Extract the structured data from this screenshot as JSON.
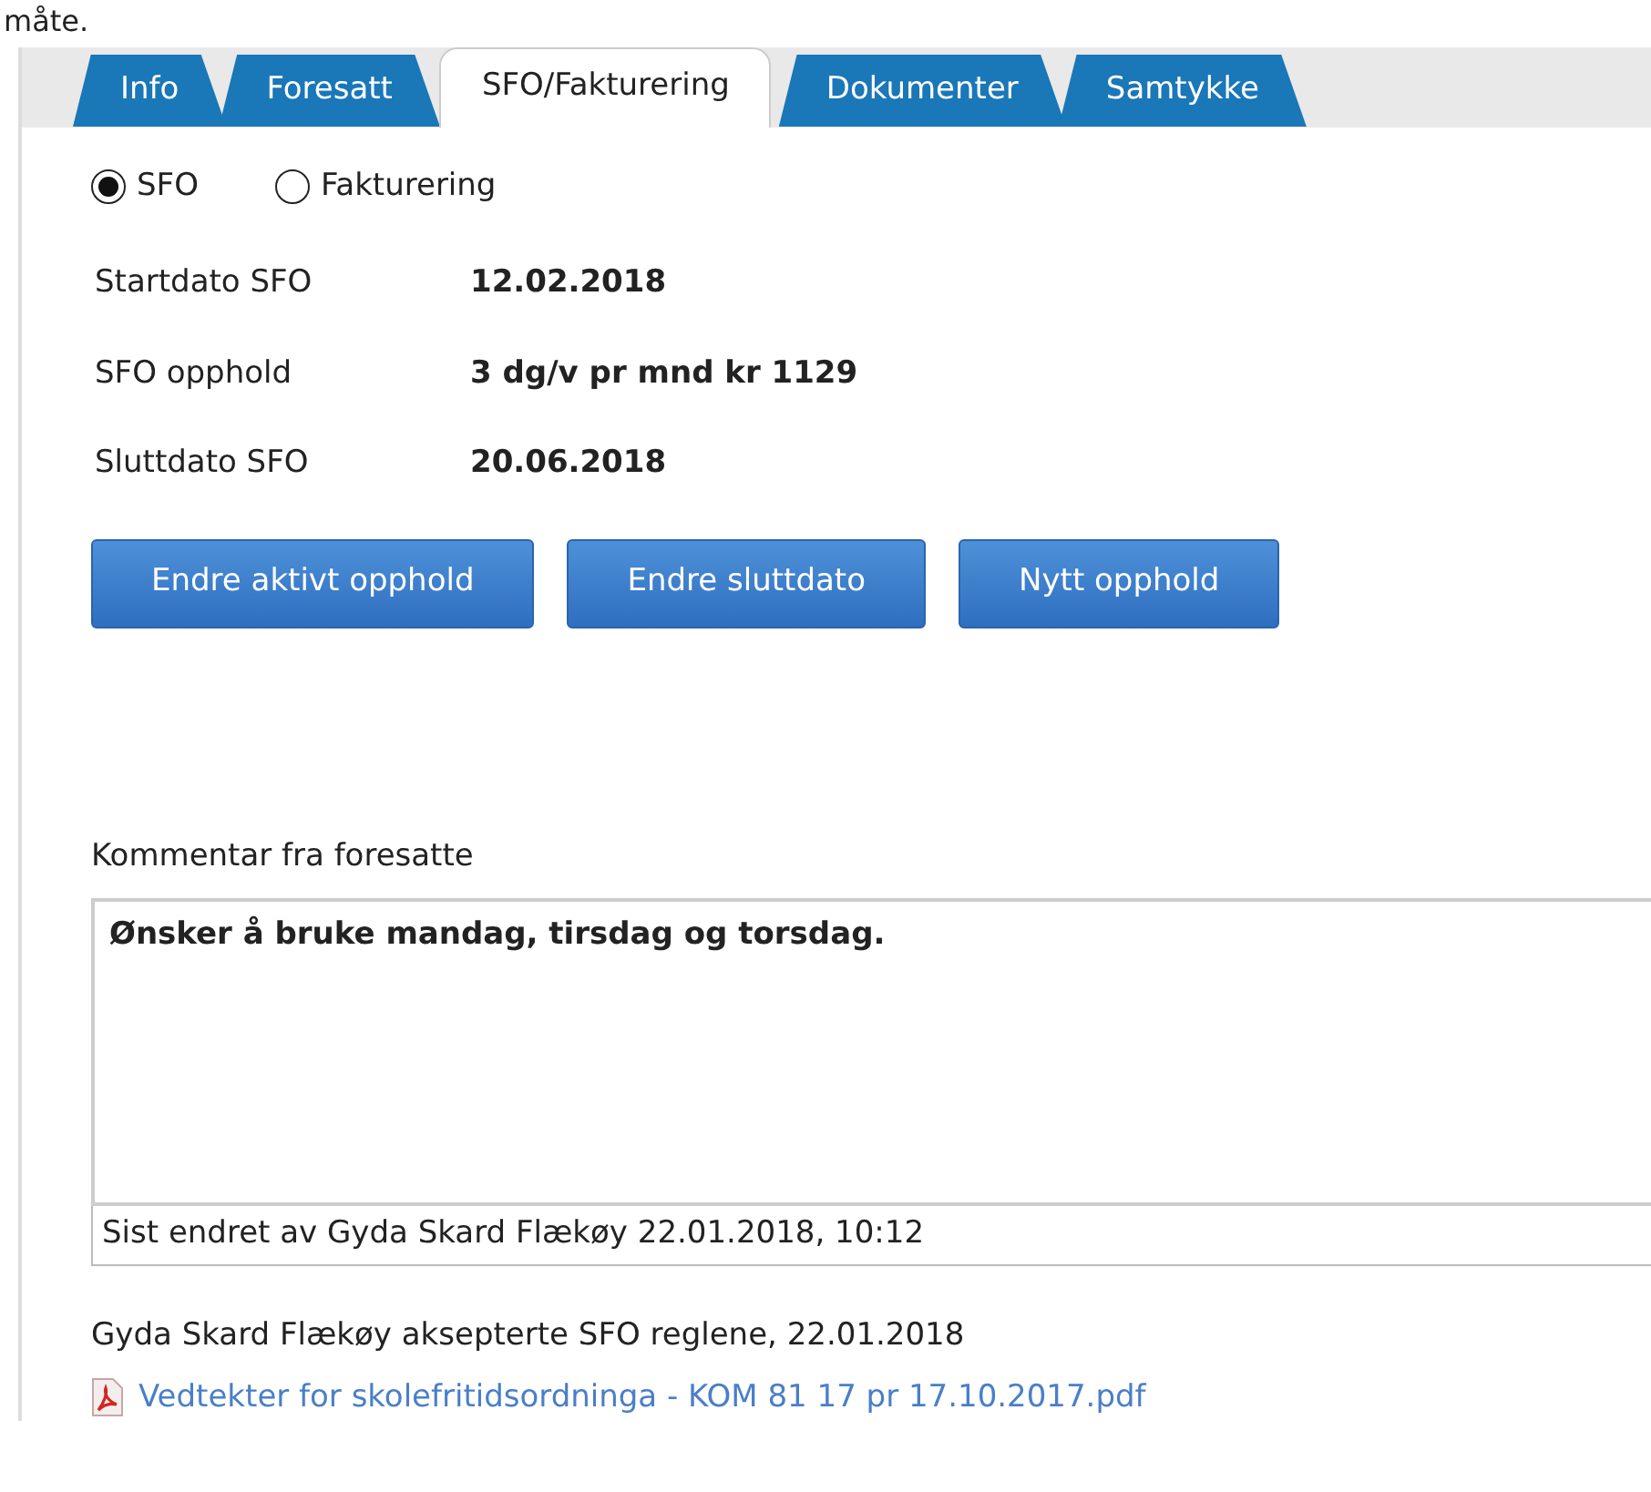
{
  "heading_fragment": "måte.",
  "tabs": [
    {
      "label": "Info",
      "selected": false
    },
    {
      "label": "Foresatt",
      "selected": false
    },
    {
      "label": "SFO/Fakturering",
      "selected": true
    },
    {
      "label": "Dokumenter",
      "selected": false
    },
    {
      "label": "Samtykke",
      "selected": false
    }
  ],
  "radios": [
    {
      "label": "SFO",
      "selected": true
    },
    {
      "label": "Fakturering",
      "selected": false
    }
  ],
  "fields": [
    {
      "label": "Startdato SFO",
      "value": "12.02.2018"
    },
    {
      "label": "SFO opphold",
      "value": "3 dg/v pr mnd kr 1129"
    },
    {
      "label": "Sluttdato SFO",
      "value": "20.06.2018"
    }
  ],
  "buttons": [
    "Endre aktivt opphold",
    "Endre sluttdato",
    "Nytt opphold"
  ],
  "comment": {
    "label": "Kommentar fra foresatte",
    "value": "Ønsker å bruke mandag, tirsdag og torsdag.",
    "last_changed": "Sist endret av Gyda Skard Flækøy 22.01.2018, 10:12"
  },
  "acceptance": "Gyda Skard Flækøy aksepterte SFO reglene, 22.01.2018",
  "attachment": {
    "label": "Vedtekter for skolefritidsordninga - KOM 81 17 pr 17.10.2017.pdf"
  }
}
